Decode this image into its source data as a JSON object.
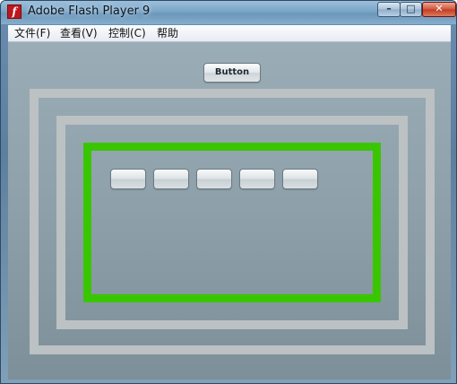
{
  "window": {
    "title": "Adobe Flash Player 9",
    "app_icon_glyph": "f",
    "controls": {
      "minimize_glyph": "–",
      "maximize_glyph": "□",
      "close_glyph": "✕"
    }
  },
  "menubar": {
    "items": [
      {
        "label": "文件(F)"
      },
      {
        "label": "查看(V)"
      },
      {
        "label": "控制(C)"
      },
      {
        "label": "帮助"
      }
    ]
  },
  "stage": {
    "top_button_label": "Button",
    "small_buttons": [
      "",
      "",
      "",
      "",
      ""
    ],
    "colors": {
      "frame_gray": "#bcc1c4",
      "frame_green": "#39c600"
    }
  }
}
